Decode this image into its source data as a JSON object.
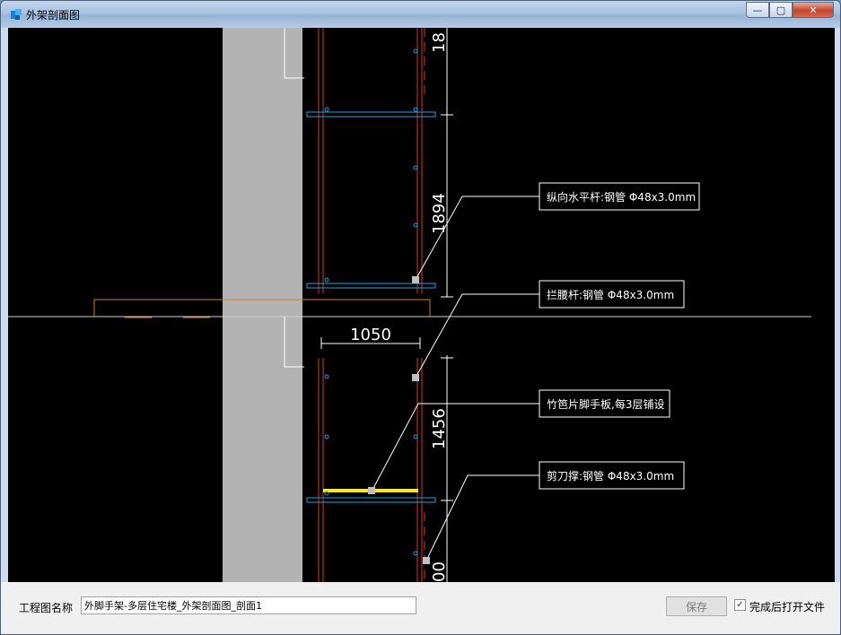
{
  "window": {
    "title": "外架剖面图",
    "controls": {
      "minimize": "—",
      "maximize": "▢",
      "close": "✕"
    }
  },
  "drawing": {
    "dimensions": {
      "top_partial": "18",
      "middle_height": "1894",
      "bay_width": "1050",
      "lower_height": "1456",
      "bottom_partial": "00"
    },
    "callouts": [
      {
        "text": "纵向水平杆:钢管 Φ48x3.0mm"
      },
      {
        "text": "拦腰杆:钢管 Φ48x3.0mm"
      },
      {
        "text": "竹笆片脚手板,每3层铺设"
      },
      {
        "text": "剪刀撑:钢管 Φ48x3.0mm"
      }
    ],
    "colors": {
      "background": "#000000",
      "wall": "#b3b3b3",
      "pole": "#e03030",
      "ledger": "#1aa3e0",
      "platform": "#ffee00",
      "slab": "#d9792a",
      "annotation": "#ffffff"
    }
  },
  "form": {
    "name_label": "工程图名称",
    "name_value": "外脚手架-多层住宅楼_外架剖面图_剖面1",
    "save_label": "保存",
    "open_after_label": "完成后打开文件",
    "open_after_checked": true,
    "check_mark": "✓"
  }
}
